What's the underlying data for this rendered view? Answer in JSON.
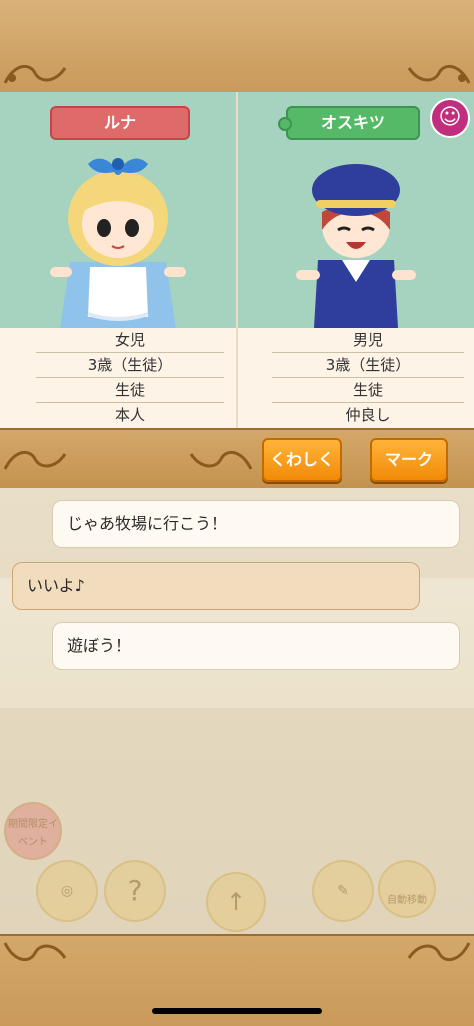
{
  "characters": {
    "left": {
      "name": "ルナ",
      "gender": "女児",
      "age": "3歳（生徒）",
      "role": "生徒",
      "relation": "本人"
    },
    "right": {
      "name": "オスキツ",
      "badge_icon": "smile-icon",
      "gender": "男児",
      "age": "3歳（生徒）",
      "role": "生徒",
      "relation": "仲良し"
    }
  },
  "buttons": {
    "detail": "くわしく",
    "mark": "マーク"
  },
  "chat": [
    {
      "text": "じゃあ牧場に行こう！"
    },
    {
      "text": "いいよ♪"
    },
    {
      "text": "遊ぼう！"
    }
  ],
  "hud": {
    "event_label": "期間限定イベント",
    "auto_label": "自動移動"
  },
  "colors": {
    "accent_orange": "#f28a08",
    "tag_pink": "#df6a6a",
    "tag_green": "#56b968",
    "panel_bg": "#a6d3bf",
    "frame_gold": "#c99a5a"
  }
}
